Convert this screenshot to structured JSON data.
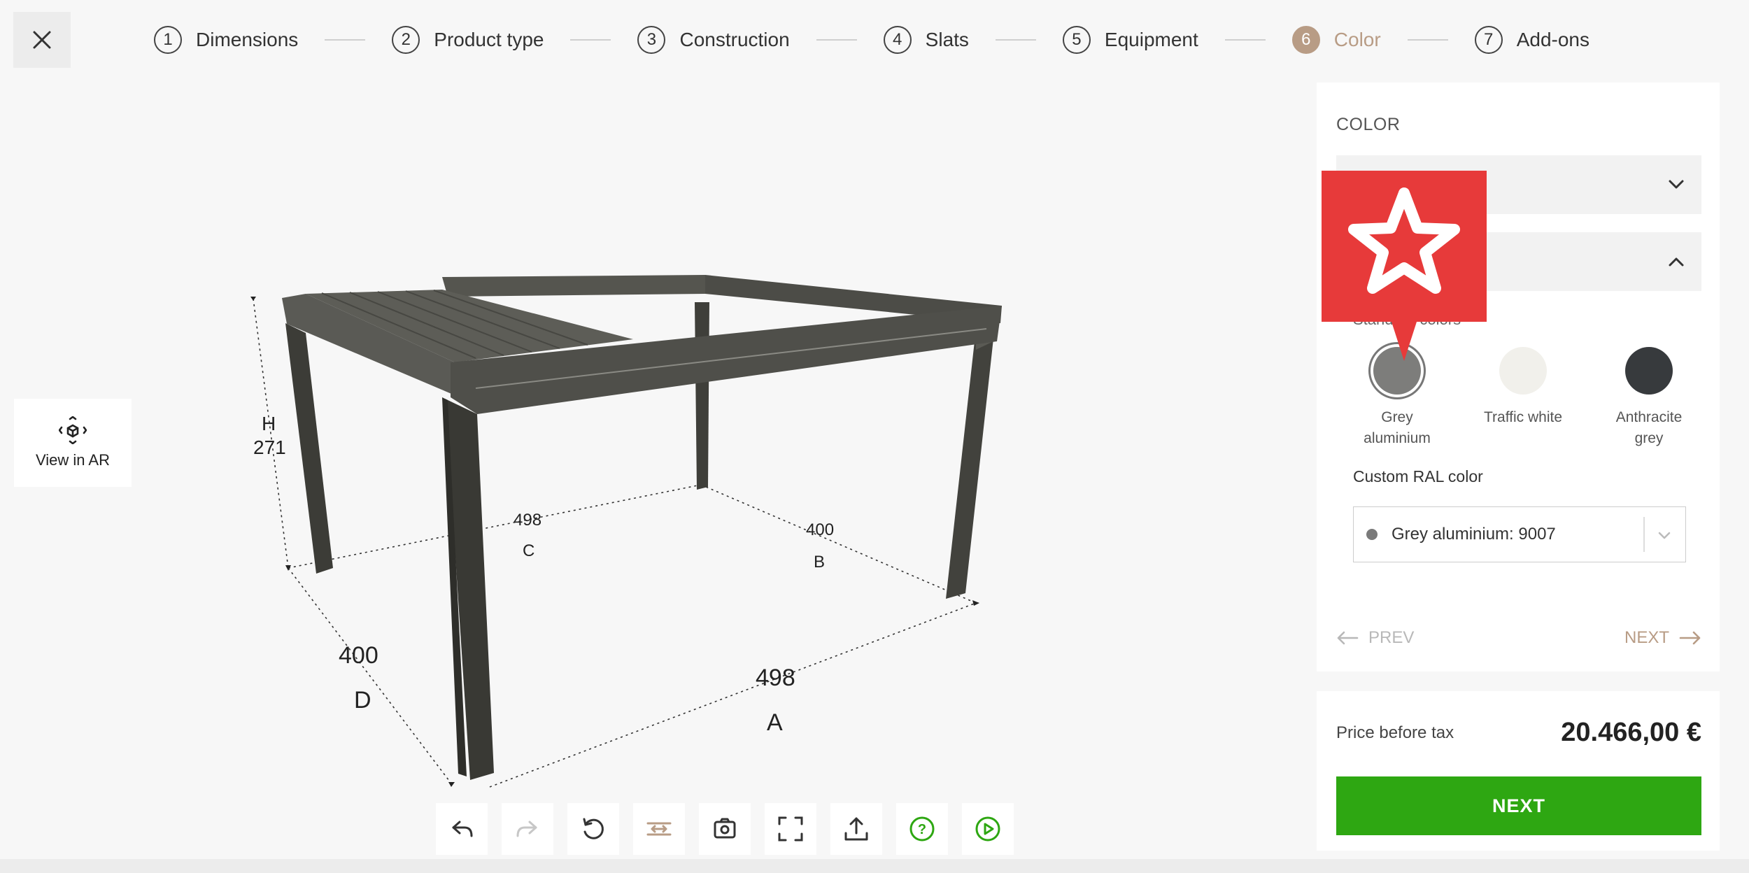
{
  "stepper": [
    {
      "num": "1",
      "label": "Dimensions"
    },
    {
      "num": "2",
      "label": "Product type"
    },
    {
      "num": "3",
      "label": "Construction"
    },
    {
      "num": "4",
      "label": "Slats"
    },
    {
      "num": "5",
      "label": "Equipment"
    },
    {
      "num": "6",
      "label": "Color",
      "active": true
    },
    {
      "num": "7",
      "label": "Add-ons"
    }
  ],
  "viewport": {
    "ar_label": "View in AR",
    "dims": {
      "h_letter": "H",
      "h_value": "271",
      "c_value": "498",
      "c_letter": "C",
      "b_value": "400",
      "b_letter": "B",
      "d_value": "400",
      "d_letter": "D",
      "a_value": "498",
      "a_letter": "A"
    }
  },
  "panel": {
    "title": "COLOR",
    "section_label": "Standard colors",
    "swatches": [
      {
        "label1": "Grey",
        "label2": "aluminium",
        "color": "#7d7d7b",
        "selected": true
      },
      {
        "label1": "Traffic white",
        "label2": "",
        "color": "#f1f0eb",
        "selected": false
      },
      {
        "label1": "Anthracite",
        "label2": "grey",
        "color": "#373a3d",
        "selected": false
      }
    ],
    "custom_label": "Custom RAL color",
    "custom_value": "Grey aluminium: 9007",
    "prev": "PREV",
    "next": "NEXT"
  },
  "price": {
    "label": "Price before tax",
    "value": "20.466,00 €",
    "next_button": "NEXT"
  },
  "colors": {
    "accent": "#b89c85",
    "primary_button": "#2ea712",
    "badge": "#e73a3a",
    "structure": "#4a4a45"
  }
}
